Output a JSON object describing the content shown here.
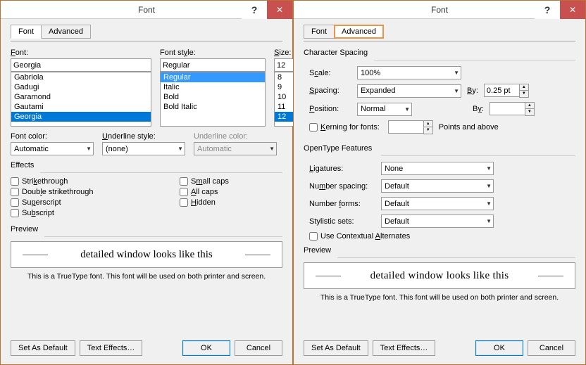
{
  "title": "Font",
  "tabs": {
    "font": "Font",
    "advanced": "Advanced"
  },
  "left": {
    "labels": {
      "font": "Font:",
      "fontStyle": "Font style:",
      "size": "Size:",
      "fontColor": "Font color:",
      "underlineStyle": "Underline style:",
      "underlineColor": "Underline color:",
      "effects": "Effects",
      "preview": "Preview"
    },
    "fontValue": "Georgia",
    "fontList": [
      "Gabriola",
      "Gadugi",
      "Garamond",
      "Gautami",
      "Georgia"
    ],
    "fontSelected": "Georgia",
    "styleValue": "Regular",
    "styleList": [
      "Regular",
      "Italic",
      "Bold",
      "Bold Italic"
    ],
    "styleSelected": "Regular",
    "sizeValue": "12",
    "sizeList": [
      "8",
      "9",
      "10",
      "11",
      "12"
    ],
    "sizeSelected": "12",
    "fontColor": "Automatic",
    "underlineStyle": "(none)",
    "underlineColor": "Automatic",
    "effects": {
      "strike": "Strikethrough",
      "dstrike": "Double strikethrough",
      "super": "Superscript",
      "sub": "Subscript",
      "scaps": "Small caps",
      "acaps": "All caps",
      "hidden": "Hidden"
    }
  },
  "right": {
    "labels": {
      "charSpacing": "Character Spacing",
      "scale": "Scale:",
      "spacing": "Spacing:",
      "position": "Position:",
      "by": "By:",
      "kerning": "Kerning for fonts:",
      "pointsAbove": "Points and above",
      "otFeatures": "OpenType Features",
      "ligatures": "Ligatures:",
      "numSpacing": "Number spacing:",
      "numForms": "Number forms:",
      "stylistic": "Stylistic sets:",
      "contextual": "Use Contextual Alternates",
      "preview": "Preview"
    },
    "scale": "100%",
    "spacing": "Expanded",
    "spacingBy": "0.25 pt",
    "position": "Normal",
    "positionBy": "",
    "kerningVal": "",
    "ligatures": "None",
    "numSpacing": "Default",
    "numForms": "Default",
    "stylistic": "Default"
  },
  "previewText": "detailed window looks like this",
  "footnote": "This is a TrueType font. This font will be used on both printer and screen.",
  "buttons": {
    "setDefault": "Set As Default",
    "textEffects": "Text Effects…",
    "ok": "OK",
    "cancel": "Cancel"
  }
}
